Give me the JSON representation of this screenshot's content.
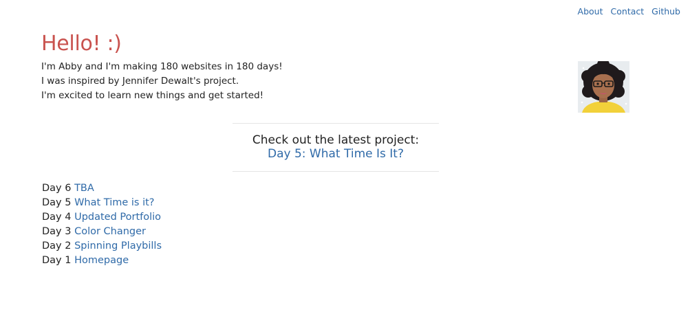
{
  "nav": {
    "items": [
      "About",
      "Contact",
      "Github"
    ]
  },
  "header": {
    "title": "Hello! :)"
  },
  "intro": {
    "lines": [
      "I'm Abby and I'm making 180 websites in 180 days!",
      "I was inspired by Jennifer Dewalt's project.",
      "I'm excited to learn new things and get started!"
    ]
  },
  "latest": {
    "heading": "Check out the latest project:",
    "link": "Day 5: What Time Is It?"
  },
  "days": [
    {
      "day": "Day 6",
      "title": "TBA"
    },
    {
      "day": "Day 5",
      "title": "What Time is it?"
    },
    {
      "day": "Day 4",
      "title": "Updated Portfolio"
    },
    {
      "day": "Day 3",
      "title": "Color Changer"
    },
    {
      "day": "Day 2",
      "title": "Spinning Playbills"
    },
    {
      "day": "Day 1",
      "title": "Homepage"
    }
  ],
  "colors": {
    "title": "#c9534f",
    "link": "#2f6aa8",
    "text": "#222222"
  }
}
